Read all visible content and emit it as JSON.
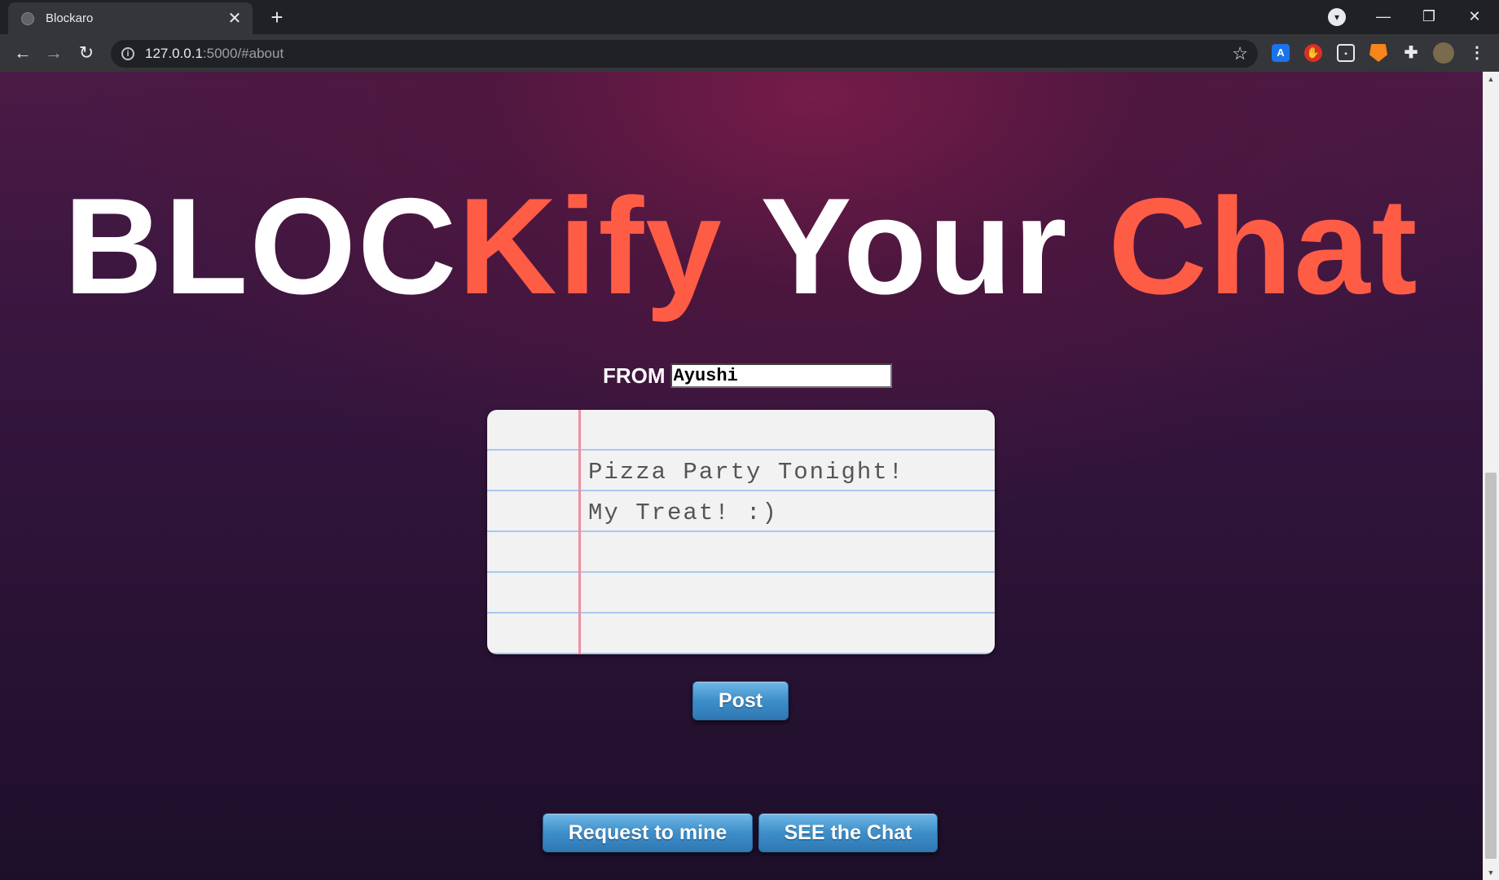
{
  "browser": {
    "tab_title": "Blockaro",
    "new_tab": "+",
    "url_host": "127.0.0.1",
    "url_rest": ":5000/#about"
  },
  "hero": {
    "part1": "BLOC",
    "part2": "Kify",
    "part3": " Your ",
    "part4": "Chat"
  },
  "form": {
    "from_label": "FROM",
    "from_value": "Ayushi",
    "message": "Pizza Party Tonight!\nMy Treat! :)"
  },
  "buttons": {
    "post": "Post",
    "request": "Request to mine",
    "see_chat": "SEE the Chat"
  },
  "colors": {
    "accent": "#ff5c45",
    "button": "#3d8ec9"
  }
}
